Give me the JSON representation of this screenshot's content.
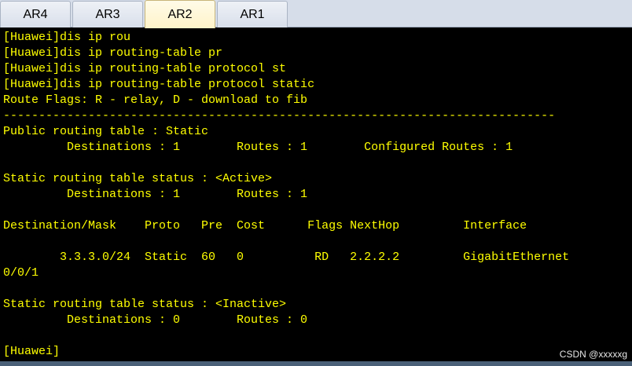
{
  "tabs": [
    {
      "label": "AR4"
    },
    {
      "label": "AR3"
    },
    {
      "label": "AR2"
    },
    {
      "label": "AR1"
    }
  ],
  "active_tab": "AR2",
  "terminal": {
    "lines": [
      "[Huawei]dis ip rou",
      "[Huawei]dis ip routing-table pr",
      "[Huawei]dis ip routing-table protocol st",
      "[Huawei]dis ip routing-table protocol static",
      "Route Flags: R - relay, D - download to fib",
      "------------------------------------------------------------------------------",
      "Public routing table : Static",
      "         Destinations : 1        Routes : 1        Configured Routes : 1",
      "",
      "Static routing table status : <Active>",
      "         Destinations : 1        Routes : 1",
      "",
      "Destination/Mask    Proto   Pre  Cost      Flags NextHop         Interface",
      "",
      "        3.3.3.0/24  Static  60   0          RD   2.2.2.2         GigabitEthernet",
      "0/0/1",
      "",
      "Static routing table status : <Inactive>",
      "         Destinations : 0        Routes : 0",
      "",
      "[Huawei]"
    ]
  },
  "colors": {
    "terminal_bg": "#000000",
    "terminal_fg": "#ffff00",
    "tabbar_bg": "#d6dde9",
    "active_tab_bg": "#fff3c9"
  },
  "watermark": "CSDN @xxxxxg"
}
